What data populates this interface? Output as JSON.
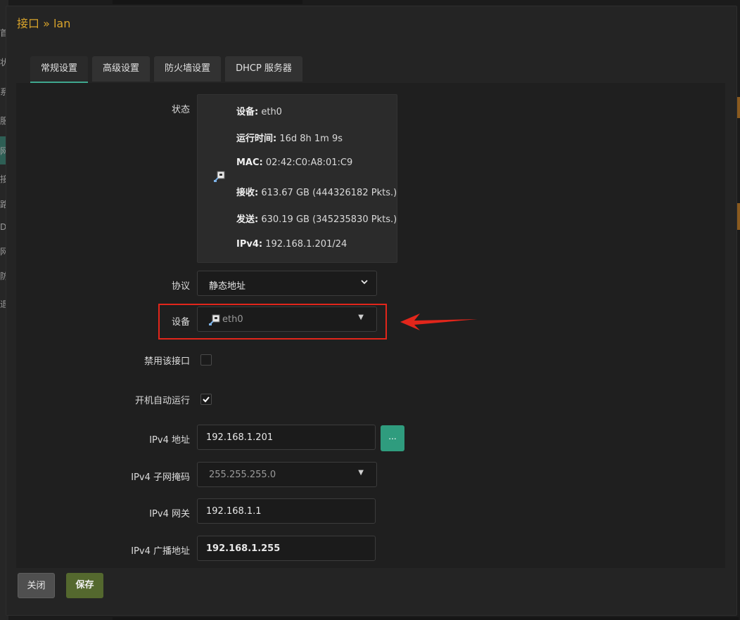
{
  "background_sidebar": [
    "首",
    "状",
    "系",
    "服",
    "网",
    "接",
    "路",
    "D",
    "网",
    "防",
    "退"
  ],
  "title": "接口 » lan",
  "tabs": [
    {
      "label": "常规设置",
      "active": true
    },
    {
      "label": "高级设置",
      "active": false
    },
    {
      "label": "防火墙设置",
      "active": false
    },
    {
      "label": "DHCP 服务器",
      "active": false
    }
  ],
  "status": {
    "label": "状态",
    "device_key": "设备:",
    "device_val": "eth0",
    "uptime_key": "运行时间:",
    "uptime_val": "16d 8h 1m 9s",
    "mac_key": "MAC:",
    "mac_val": "02:42:C0:A8:01:C9",
    "rx_key": "接收:",
    "rx_val": "613.67 GB (444326182 Pkts.)",
    "tx_key": "发送:",
    "tx_val": "630.19 GB (345235830 Pkts.)",
    "ipv4_key": "IPv4:",
    "ipv4_val": "192.168.1.201/24"
  },
  "protocol": {
    "label": "协议",
    "value": "静态地址"
  },
  "device": {
    "label": "设备",
    "value": "eth0"
  },
  "disable_iface": {
    "label": "禁用该接口",
    "checked": false
  },
  "autostart": {
    "label": "开机自动运行",
    "checked": true
  },
  "ipv4_addr": {
    "label": "IPv4 地址",
    "value": "192.168.1.201",
    "more_button": "..."
  },
  "ipv4_mask": {
    "label": "IPv4 子网掩码",
    "value": "255.255.255.0"
  },
  "ipv4_gateway": {
    "label": "IPv4 网关",
    "value": "192.168.1.1"
  },
  "ipv4_broadcast": {
    "label": "IPv4 广播地址",
    "value": "192.168.1.255"
  },
  "buttons": {
    "close": "关闭",
    "save": "保存"
  },
  "colors": {
    "accent": "#3fa88f",
    "title": "#d9a42b",
    "highlight": "#e2261b",
    "save": "#54682e"
  }
}
